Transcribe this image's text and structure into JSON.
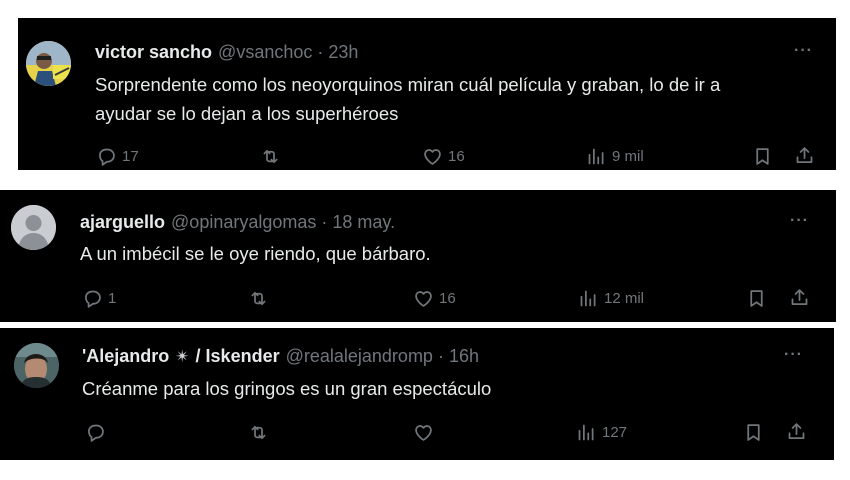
{
  "tweets": [
    {
      "name": "victor sancho",
      "handle": "@vsanchoc",
      "separator": "·",
      "time": "23h",
      "text_line1": "Sorprendente como los neoyorquinos miran cuál película y graban, lo de ir a",
      "text_line2": "ayudar se lo dejan a los superhéroes",
      "replies": "17",
      "retweets": "",
      "likes": "16",
      "views": "9 mil"
    },
    {
      "name": "ajarguello",
      "handle": "@opinaryalgomas",
      "separator": "·",
      "time": "18 may.",
      "text_line1": "A un imbécil se le oye riendo, que bárbaro.",
      "replies": "1",
      "retweets": "",
      "likes": "16",
      "views": "12 mil"
    },
    {
      "name_part1": "'Alejandro",
      "name_emoji": "✴",
      "name_part2": "/ Iskender",
      "handle": "@realalejandromp",
      "separator": "·",
      "time": "16h",
      "text_line1": "Créanme para los gringos es un gran espectáculo",
      "replies": "",
      "retweets": "",
      "likes": "",
      "views": "127"
    }
  ],
  "more_label": "···",
  "colors": {
    "background": "#000000",
    "text": "#e7e9ea",
    "muted": "#71767b"
  },
  "icons": [
    "reply-icon",
    "retweet-icon",
    "like-icon",
    "views-icon",
    "bookmark-icon",
    "share-icon",
    "more-icon"
  ]
}
